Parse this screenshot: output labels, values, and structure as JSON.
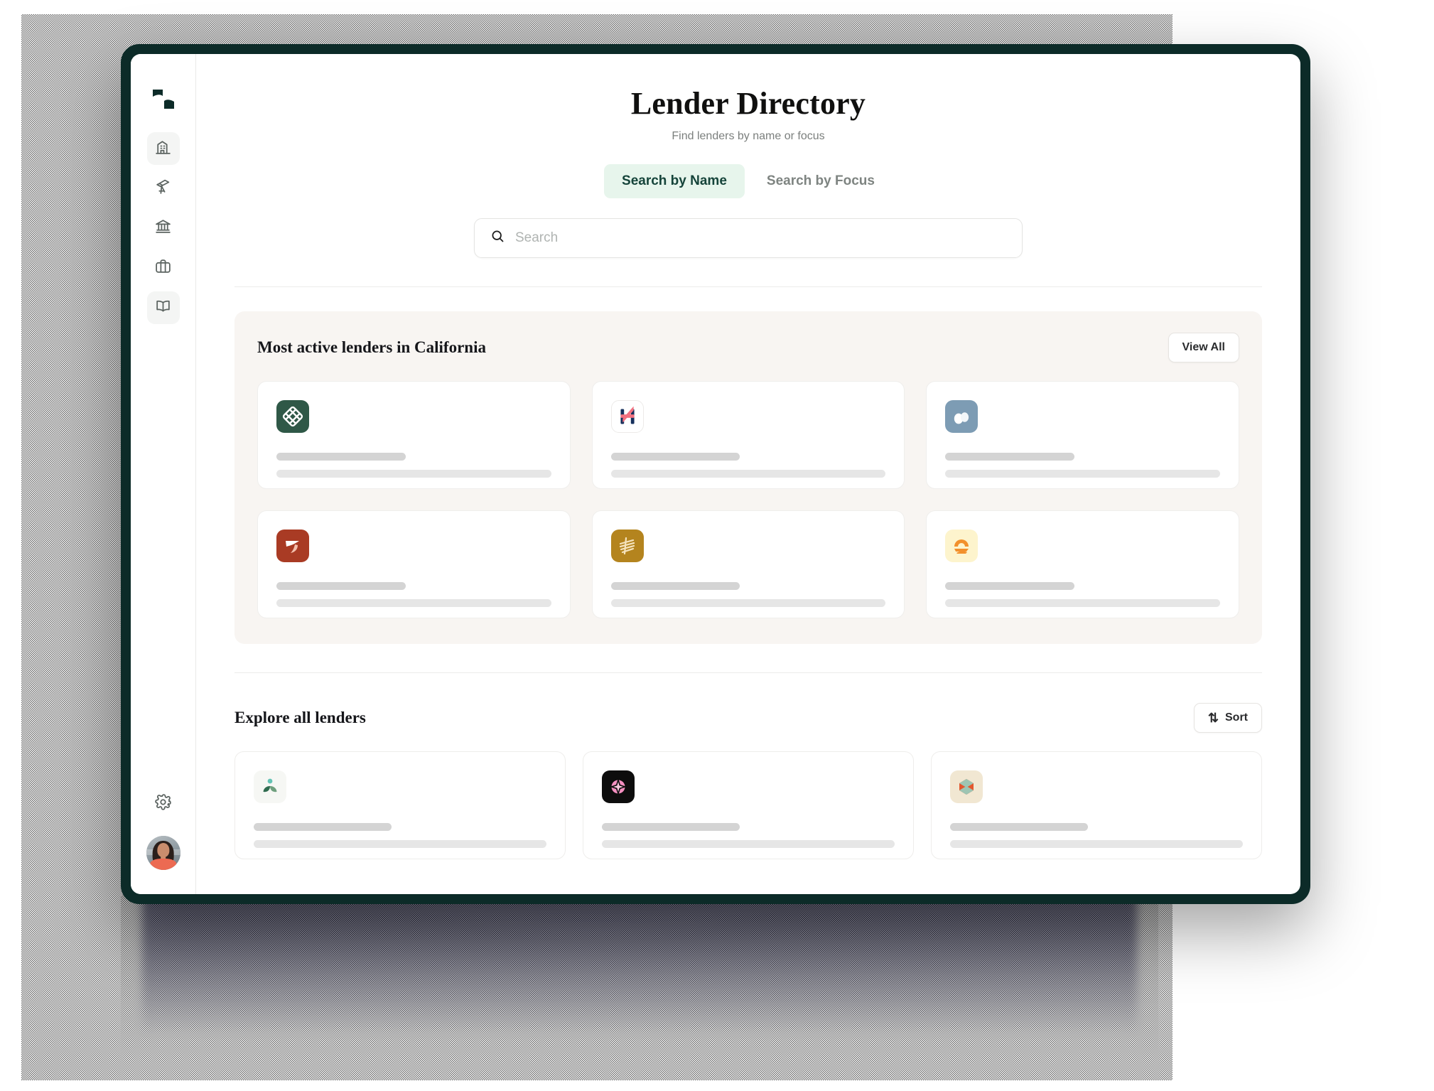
{
  "window": {
    "frame_color": "#0c2b28"
  },
  "sidebar": {
    "logo_name": "app-logo",
    "items": [
      {
        "icon": "building-icon",
        "name": "sidebar-item-companies",
        "active": true
      },
      {
        "icon": "telescope-icon",
        "name": "sidebar-item-discover",
        "active": false
      },
      {
        "icon": "bank-icon",
        "name": "sidebar-item-lenders",
        "active": false
      },
      {
        "icon": "briefcase-icon",
        "name": "sidebar-item-portfolio",
        "active": false
      },
      {
        "icon": "book-icon",
        "name": "sidebar-item-library",
        "active": true
      }
    ],
    "settings_icon": "gear-icon",
    "avatar_name": "user-avatar"
  },
  "header": {
    "title": "Lender Directory",
    "subtitle": "Find lenders by name or focus"
  },
  "tabs": [
    {
      "label": "Search by Name",
      "active": true
    },
    {
      "label": "Search by Focus",
      "active": false
    }
  ],
  "search": {
    "icon": "search-icon",
    "value": "",
    "placeholder": "Search"
  },
  "featured": {
    "title": "Most active lenders in California",
    "view_all_label": "View All",
    "cards": [
      {
        "logo": "woven-diamond-logo",
        "tile_color": "#2f5847",
        "mark_color": "#ffffff"
      },
      {
        "logo": "h-monogram-logo",
        "tile_color": "#ffffff",
        "mark_color": "#f4707f"
      },
      {
        "logo": "cloud-blob-logo",
        "tile_color": "#7d9cb4",
        "mark_color": "#ffffff"
      },
      {
        "logo": "leaf-swoosh-logo",
        "tile_color": "#a93b24",
        "mark_color": "#ffffff"
      },
      {
        "logo": "diagonal-lines-logo",
        "tile_color": "#b4841e",
        "mark_color": "#f5e3bd"
      },
      {
        "logo": "sunrise-hills-logo",
        "tile_color": "#fdf4cd",
        "mark_color": "#f2902c"
      }
    ]
  },
  "explore": {
    "title": "Explore all lenders",
    "sort_label": "Sort",
    "sort_icon": "sort-arrows-icon",
    "cards": [
      {
        "logo": "sprout-logo",
        "tile_color": "#f6f7f4",
        "mark_color": "#2f6b4f"
      },
      {
        "logo": "pink-sparkle-logo",
        "tile_color": "#0d0d0d",
        "mark_color": "#f48fc0"
      },
      {
        "logo": "iso-cube-logo",
        "tile_color": "#f1e7d2",
        "mark_color": "#e4572e"
      }
    ]
  }
}
